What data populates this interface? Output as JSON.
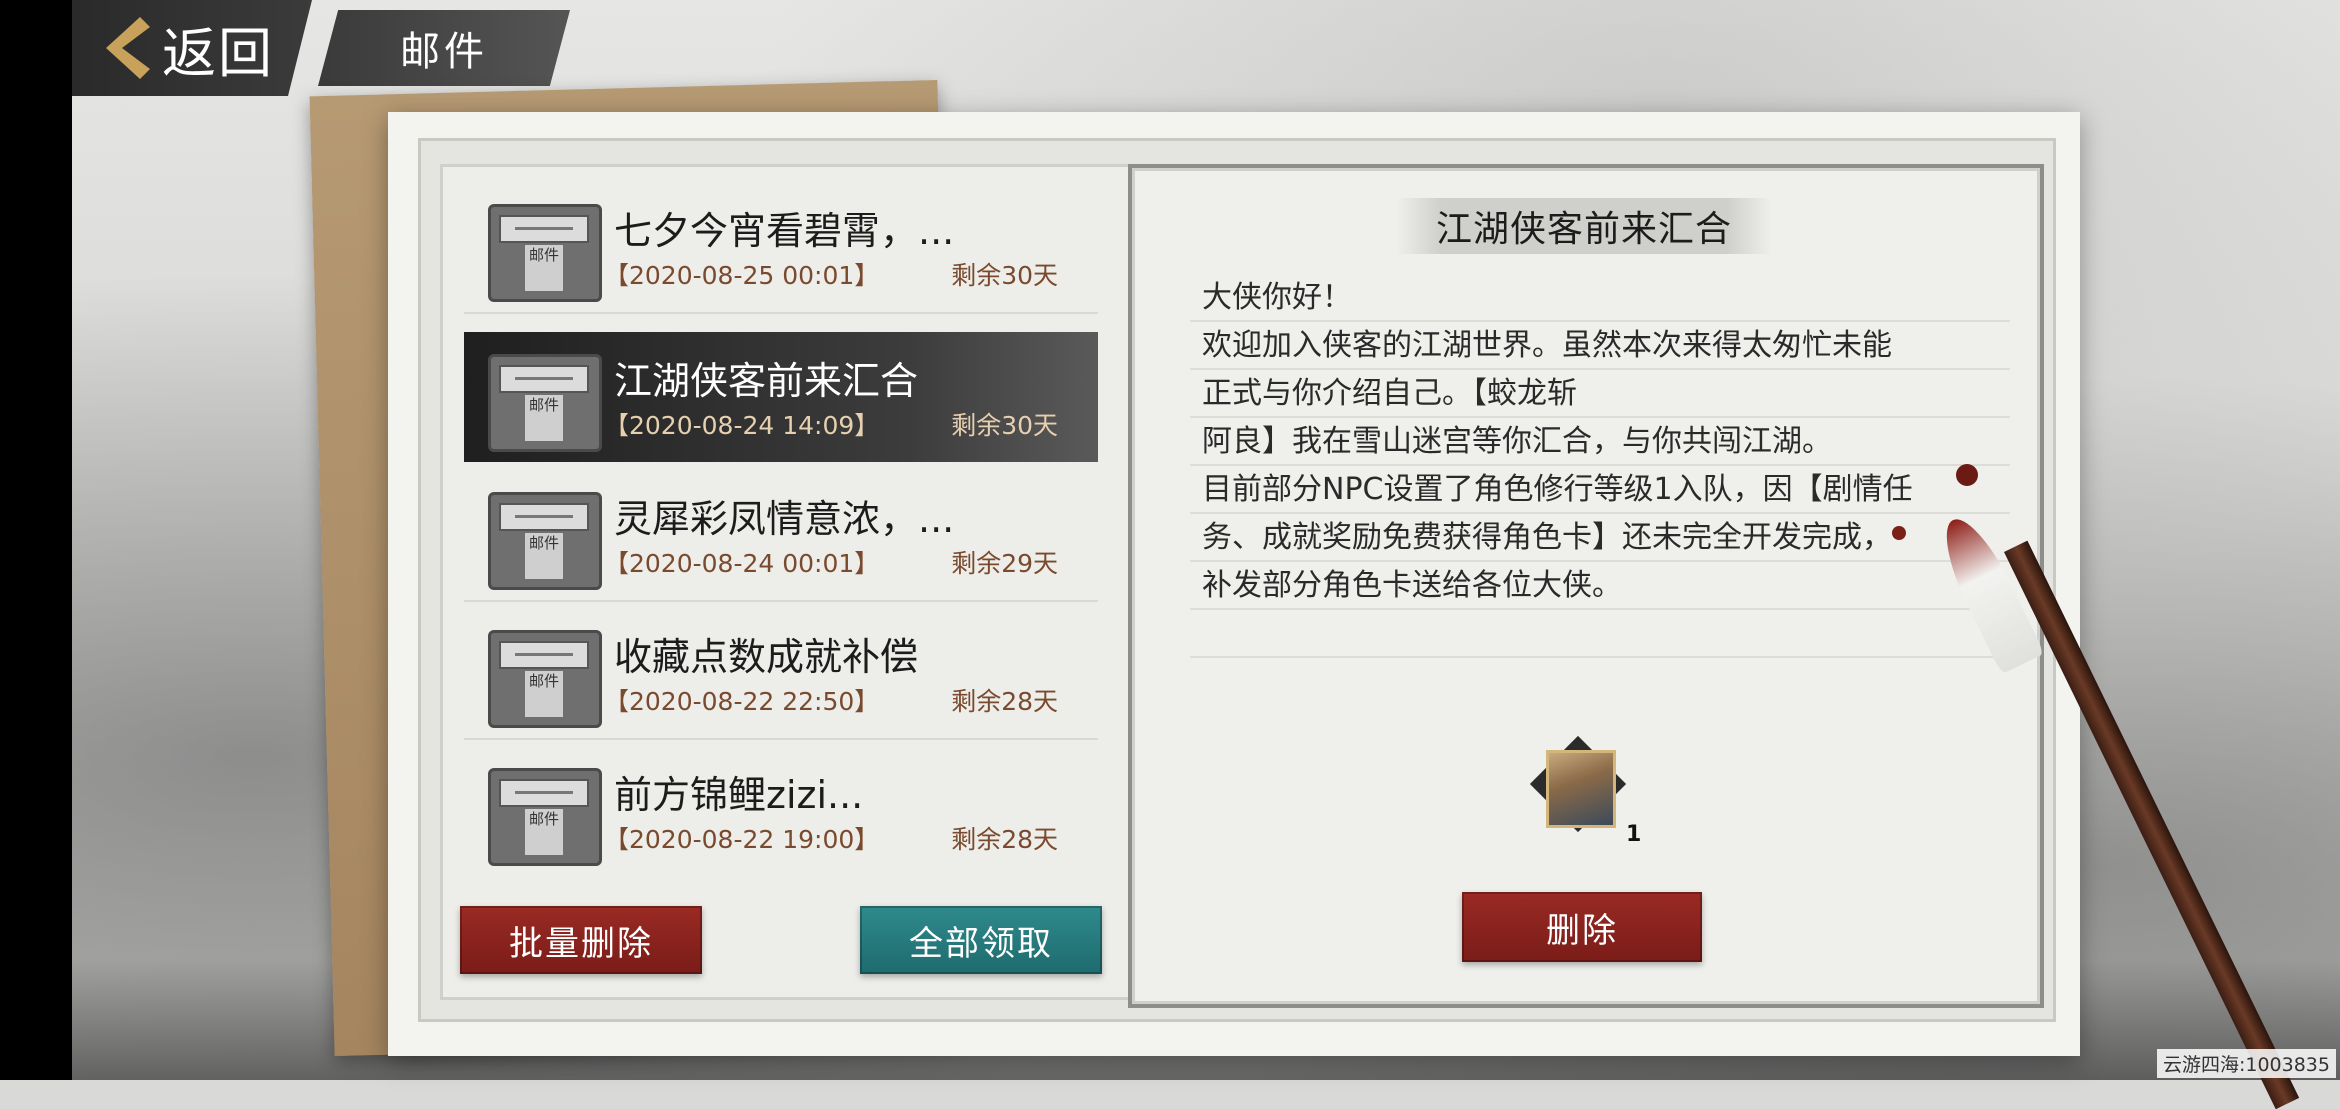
{
  "header": {
    "back_label": "返回",
    "title": "邮件"
  },
  "mail_icon_label": "邮件",
  "mails": [
    {
      "title": "七夕今宵看碧霄，...",
      "date": "【2020-08-25 00:01】",
      "remaining": "剩余30天"
    },
    {
      "title": "江湖侠客前来汇合",
      "date": "【2020-08-24 14:09】",
      "remaining": "剩余30天"
    },
    {
      "title": "灵犀彩凤情意浓，...",
      "date": "【2020-08-24 00:01】",
      "remaining": "剩余29天"
    },
    {
      "title": "收藏点数成就补偿",
      "date": "【2020-08-22 22:50】",
      "remaining": "剩余28天"
    },
    {
      "title": "前方锦鲤zizi...",
      "date": "【2020-08-22 19:00】",
      "remaining": "剩余28天"
    }
  ],
  "selected_index": 1,
  "buttons": {
    "batch_delete": "批量删除",
    "claim_all": "全部领取",
    "delete": "删除"
  },
  "detail": {
    "title": "江湖侠客前来汇合",
    "lines": [
      "大侠你好！",
      "欢迎加入侠客的江湖世界。虽然本次来得太匆忙未能",
      "正式与你介绍自己。【蛟龙斩",
      "阿良】我在雪山迷宫等你汇合，与你共闯江湖。",
      "目前部分NPC设置了角色修行等级1入队，因【剧情任",
      "务、成就奖励免费获得角色卡】还未完全开发完成，",
      "补发部分角色卡送给各位大侠。"
    ],
    "reward_count": "1"
  },
  "watermark": "云游四海:1003835",
  "colors": {
    "accent_red": "#8a2420",
    "accent_teal": "#257a7c",
    "date_brown": "#7a4a2e"
  }
}
